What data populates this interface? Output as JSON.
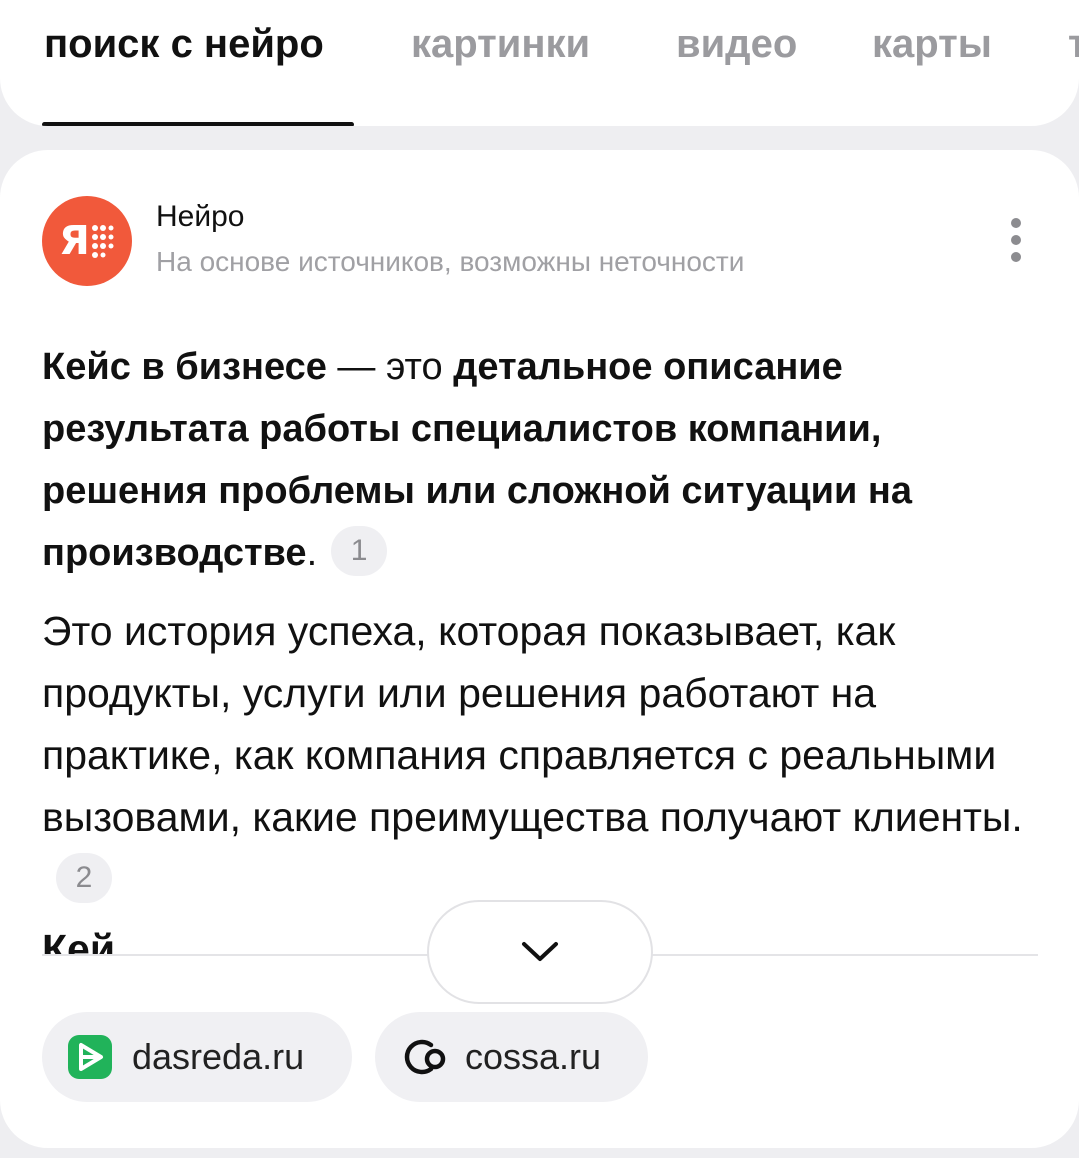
{
  "tabs": [
    {
      "label": "поиск с нейро",
      "active": true
    },
    {
      "label": "картинки",
      "active": false
    },
    {
      "label": "видео",
      "active": false
    },
    {
      "label": "карты",
      "active": false
    },
    {
      "label": "т",
      "active": false
    }
  ],
  "source": {
    "name": "Нейро",
    "subtitle": "На основе источников, возможны неточности",
    "avatar_icon": "yandex-neuro-logo",
    "avatar_color": "#f1593b"
  },
  "answer": {
    "term": "Кейс в бизнесе",
    "connector": " — это ",
    "definition": "детальное описание результата работы специалистов компании, решения проблемы или сложной ситуации на производстве",
    "end": ".",
    "ref1": "1",
    "paragraph2": "Это история успеха, которая показывает, как продукты, услуги или решения работают на практике, как компания справляется с реальными вызовами, какие преимущества получают клиенты.",
    "ref2": "2",
    "truncated_next": "Кей"
  },
  "expand_button": {
    "icon": "chevron-down-icon"
  },
  "sources": [
    {
      "label": "dasreda.ru",
      "icon": "dasreda-icon",
      "color": "#21b35a"
    },
    {
      "label": "cossa.ru",
      "icon": "cossa-icon",
      "color": "#111111"
    }
  ]
}
